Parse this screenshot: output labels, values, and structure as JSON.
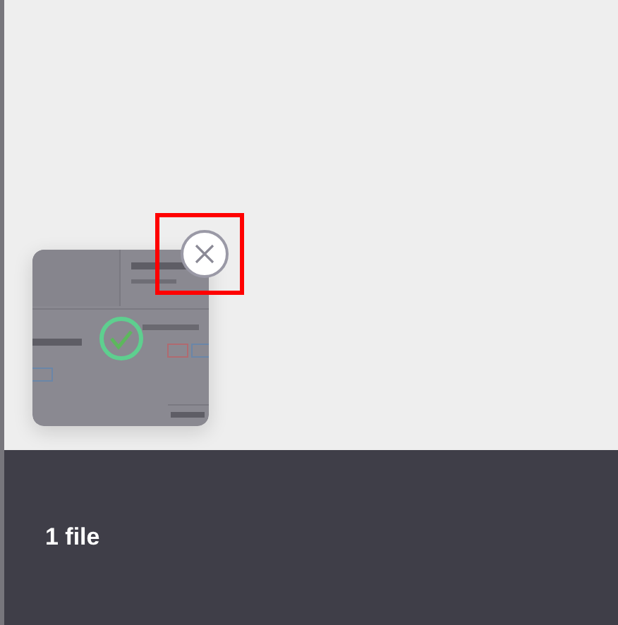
{
  "files": [
    {
      "kind": "picture",
      "done": true,
      "remove_highlighted": true
    }
  ],
  "footer": {
    "count_label": "1 file"
  }
}
